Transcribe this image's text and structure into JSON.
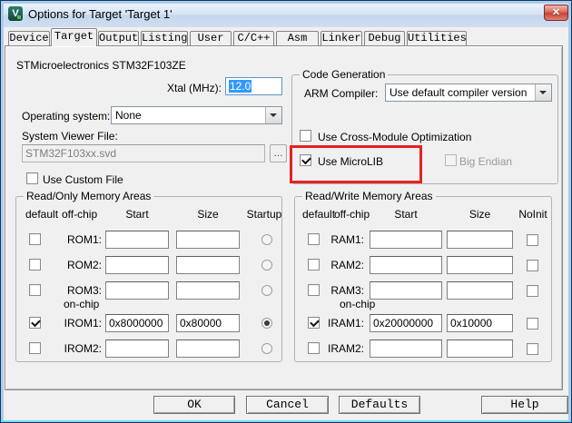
{
  "titlebar": {
    "title": "Options for Target 'Target 1'",
    "close_glyph": "✕",
    "app_icon_glyph": "V"
  },
  "tabs": [
    {
      "label": "Device",
      "active": false
    },
    {
      "label": "Target",
      "active": true
    },
    {
      "label": "Output",
      "active": false
    },
    {
      "label": "Listing",
      "active": false
    },
    {
      "label": "User",
      "active": false
    },
    {
      "label": "C/C++",
      "active": false
    },
    {
      "label": "Asm",
      "active": false
    },
    {
      "label": "Linker",
      "active": false
    },
    {
      "label": "Debug",
      "active": false
    },
    {
      "label": "Utilities",
      "active": false
    }
  ],
  "target_page": {
    "device_name": "STMicroelectronics STM32F103ZE",
    "xtal_label": "Xtal (MHz):",
    "xtal_value": "12.0",
    "os_label": "Operating system:",
    "os_value": "None",
    "svf_label": "System Viewer File:",
    "svf_value": "STM32F103xx.svd",
    "browse_label": "...",
    "use_custom_file_label": "Use Custom File",
    "code_gen": {
      "title": "Code Generation",
      "arm_compiler_label": "ARM Compiler:",
      "arm_compiler_value": "Use default compiler version",
      "cross_module": {
        "label": "Use Cross-Module Optimization",
        "checked": false
      },
      "microlib": {
        "label": "Use MicroLIB",
        "checked": true
      },
      "big_endian": {
        "label": "Big Endian",
        "checked": false,
        "disabled": true
      }
    },
    "read_only": {
      "title": "Read/Only Memory Areas",
      "headers": {
        "default": "default",
        "offchip": "off-chip",
        "start": "Start",
        "size": "Size",
        "last": "Startup"
      },
      "onchip_label": "on-chip",
      "rows": [
        {
          "label": "ROM1:",
          "checked": false,
          "start": "",
          "size": "",
          "startup": false
        },
        {
          "label": "ROM2:",
          "checked": false,
          "start": "",
          "size": "",
          "startup": false
        },
        {
          "label": "ROM3:",
          "checked": false,
          "start": "",
          "size": "",
          "startup": false
        },
        {
          "label": "IROM1:",
          "checked": true,
          "start": "0x8000000",
          "size": "0x80000",
          "startup": true
        },
        {
          "label": "IROM2:",
          "checked": false,
          "start": "",
          "size": "",
          "startup": false
        }
      ]
    },
    "read_write": {
      "title": "Read/Write Memory Areas",
      "headers": {
        "default": "default",
        "offchip": "off-chip",
        "start": "Start",
        "size": "Size",
        "last": "NoInit"
      },
      "onchip_label": "on-chip",
      "rows": [
        {
          "label": "RAM1:",
          "checked": false,
          "start": "",
          "size": "",
          "noinit": false
        },
        {
          "label": "RAM2:",
          "checked": false,
          "start": "",
          "size": "",
          "noinit": false
        },
        {
          "label": "RAM3:",
          "checked": false,
          "start": "",
          "size": "",
          "noinit": false
        },
        {
          "label": "IRAM1:",
          "checked": true,
          "start": "0x20000000",
          "size": "0x10000",
          "noinit": false
        },
        {
          "label": "IRAM2:",
          "checked": false,
          "start": "",
          "size": "",
          "noinit": false
        }
      ]
    }
  },
  "colors": {
    "highlight_red": "#e42320",
    "selection_blue": "#3399ff"
  },
  "footer_buttons": [
    "OK",
    "Cancel",
    "Defaults",
    "Help"
  ]
}
